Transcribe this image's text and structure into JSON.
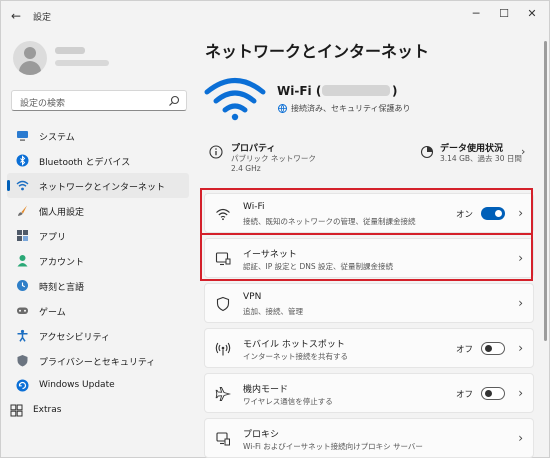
{
  "window": {
    "back": "←",
    "title": "設定",
    "minimize": "─",
    "maximize": "☐",
    "close": "✕"
  },
  "search": {
    "placeholder": "設定の検索"
  },
  "sidebar": {
    "items": [
      {
        "label": "システム"
      },
      {
        "label": "Bluetooth とデバイス"
      },
      {
        "label": "ネットワークとインターネット",
        "active": true
      },
      {
        "label": "個人用設定"
      },
      {
        "label": "アプリ"
      },
      {
        "label": "アカウント"
      },
      {
        "label": "時刻と言語"
      },
      {
        "label": "ゲーム"
      },
      {
        "label": "アクセシビリティ"
      },
      {
        "label": "プライバシーとセキュリティ"
      },
      {
        "label": "Windows Update"
      },
      {
        "label": "Extras"
      }
    ]
  },
  "main": {
    "title": "ネットワークとインターネット",
    "hero": {
      "name": "Wi-Fi (",
      "close_paren": ")",
      "status": "接続済み、セキュリティ保護あり"
    },
    "properties": {
      "title": "プロパティ",
      "line1": "パブリック ネットワーク",
      "line2": "2.4 GHz"
    },
    "data_usage": {
      "title": "データ使用状況",
      "detail": "3.14 GB、過去 30 日間",
      "chevron": "›"
    },
    "cards": [
      {
        "title": "Wi-Fi",
        "desc": "接続、既知のネットワークの管理、従量制課金接続",
        "state": "オン",
        "chevron": "›"
      },
      {
        "title": "イーサネット",
        "desc": "認証、IP 設定と DNS 設定、従量制課金接続",
        "chevron": "›"
      },
      {
        "title": "VPN",
        "desc": "追加、接続、管理",
        "chevron": "›"
      },
      {
        "title": "モバイル ホットスポット",
        "desc": "インターネット接続を共有する",
        "state": "オフ",
        "chevron": "›"
      },
      {
        "title": "機内モード",
        "desc": "ワイヤレス通信を停止する",
        "state": "オフ",
        "chevron": "›"
      },
      {
        "title": "プロキシ",
        "desc": "Wi-Fi およびイーサネット接続向けプロキシ サーバー",
        "chevron": "›"
      }
    ]
  },
  "colors": {
    "accent": "#005fb8",
    "highlight": "#d4202a",
    "background": "#f3f3f3"
  }
}
